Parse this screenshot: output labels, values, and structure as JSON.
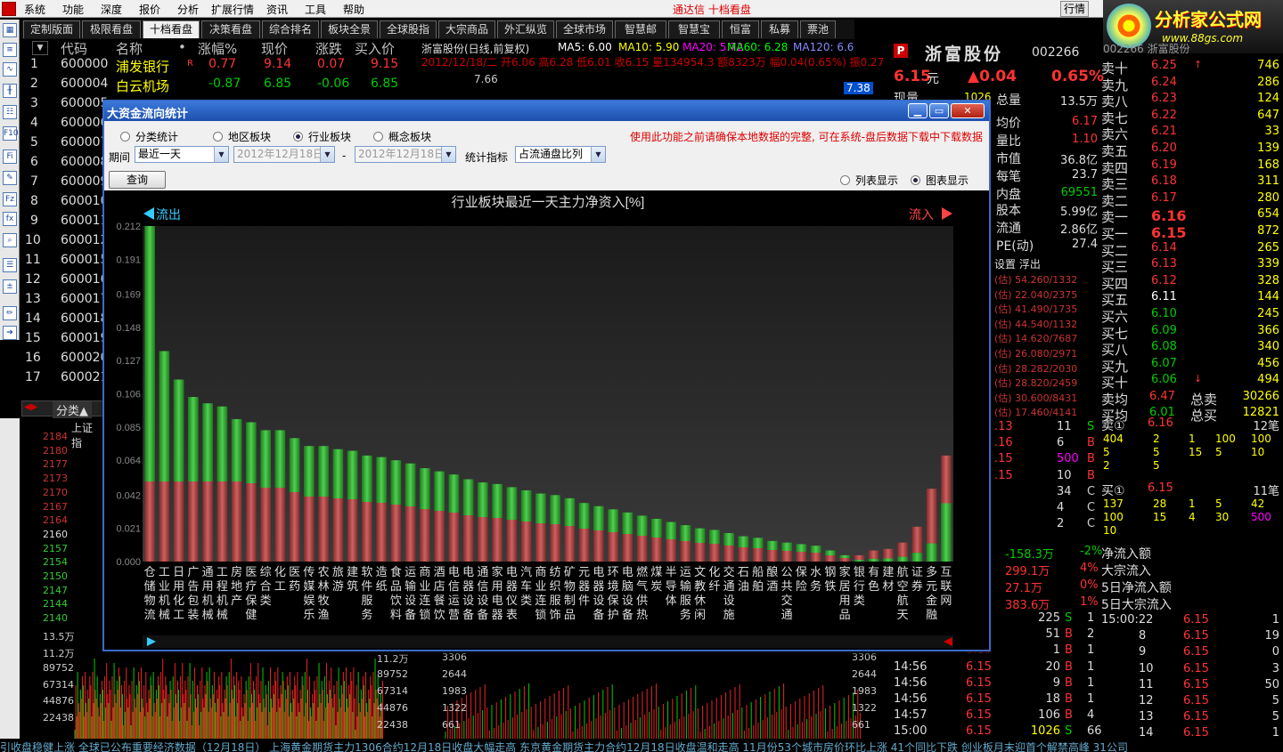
{
  "menu": {
    "items": [
      "系统",
      "功能",
      "深度",
      "报价",
      "分析",
      "扩展行情",
      "资讯",
      "工具",
      "帮助"
    ],
    "center_title": "通达信  十档看盘",
    "quote_button": "行情"
  },
  "brand": {
    "name": "分析家公式网",
    "url": "www.88gs.com"
  },
  "tabs": [
    "定制版面",
    "极限看盘",
    "十档看盘",
    "决策看盘",
    "综合排名",
    "板块全景",
    "全球股指",
    "大宗商品",
    "外汇纵览",
    "全球市场",
    "智慧邮",
    "智慧宝",
    "恒富",
    "私募",
    "票池"
  ],
  "active_tab": 2,
  "stock_list": {
    "headers": {
      "code": "代码",
      "name": "名称",
      "dot": "•",
      "change_pct": "涨幅%",
      "price": "现价",
      "change": "涨跌",
      "bid": "买入价"
    },
    "rows": [
      {
        "no": "1",
        "code": "600000",
        "name": "浦发银行",
        "flag": "R",
        "pct": "0.77",
        "price": "9.14",
        "chg": "0.07",
        "bid": "9.15"
      },
      {
        "no": "2",
        "code": "600004",
        "name": "白云机场",
        "flag": "",
        "pct": "-0.87",
        "price": "6.85",
        "chg": "-0.06",
        "bid": "6.85"
      },
      {
        "no": "3",
        "code": "600005"
      },
      {
        "no": "4",
        "code": "600006"
      },
      {
        "no": "5",
        "code": "600007"
      },
      {
        "no": "6",
        "code": "600008"
      },
      {
        "no": "7",
        "code": "600009"
      },
      {
        "no": "8",
        "code": "600010"
      },
      {
        "no": "9",
        "code": "600011"
      },
      {
        "no": "10",
        "code": "600012"
      },
      {
        "no": "11",
        "code": "600015"
      },
      {
        "no": "12",
        "code": "600016"
      },
      {
        "no": "13",
        "code": "600017"
      },
      {
        "no": "14",
        "code": "600018"
      },
      {
        "no": "15",
        "code": "600019"
      },
      {
        "no": "16",
        "code": "600020"
      },
      {
        "no": "17",
        "code": "600021"
      }
    ],
    "category_tab": "分类▲"
  },
  "kline": {
    "title": "浙富股份(日线,前复权)",
    "ma5": "MA5: 6.00",
    "ma10": "MA10: 5.90",
    "ma20": "MA20: 5.72",
    "ma60": "MA60: 6.28",
    "ma120": "MA120: 6.6",
    "line2": "2012/12/18/二 开6.06 高6.28 低6.01 收6.15 量134954.3 额8323万 幅0.04(0.65%) 振0.27",
    "high_label": "7.66",
    "price_tag": "7.38"
  },
  "index_panel": {
    "title": "上证指",
    "ticks": [
      "2184",
      "2180",
      "2177",
      "2173",
      "2170",
      "2167",
      "2164",
      "2160",
      "2157",
      "2154",
      "2150",
      "2147",
      "2144",
      "2140"
    ],
    "vol_ticks": [
      "13.5万",
      "11.2万",
      "89752",
      "67314",
      "44876",
      "22438"
    ]
  },
  "volume_panel": {
    "left_ticks": [
      "11.2万",
      "89752",
      "67314",
      "44876",
      "22438"
    ],
    "mid_ticks": [
      "3306",
      "2644",
      "1983",
      "1322",
      "661"
    ],
    "right_ticks": [
      "3306",
      "2644",
      "1983",
      "1322",
      "661"
    ]
  },
  "stock_info": {
    "name": "浙富股份",
    "code": "002266",
    "price": "6.15",
    "unit": "元",
    "chg": "▲0.04",
    "pct": "0.65%",
    "partial": "现量",
    "partial_val": "1026",
    "rows": [
      {
        "label": "总量",
        "value": "13.5万"
      },
      {
        "label": "均价",
        "value": "6.17"
      },
      {
        "label": "量比",
        "value": "1.10"
      },
      {
        "label": "市值",
        "value": "36.8亿"
      },
      {
        "label": "每笔",
        "value": "23.7"
      },
      {
        "label": "内盘",
        "value": "69551"
      },
      {
        "label": "股本",
        "value": "5.99亿"
      },
      {
        "label": "流通",
        "value": "2.86亿"
      },
      {
        "label": "PE(动)",
        "value": "27.4"
      }
    ],
    "settings": "设置 浮出",
    "est_rows": [
      "(估) 54.260/1332",
      "(估) 22.040/2375",
      "(估) 41.490/1735",
      "(估) 44.540/1132",
      "(估) 14.620/7687",
      "(估) 26.080/2971",
      "(估) 28.282/2030",
      "(估) 28.820/2459",
      "(估) 30.600/8431",
      "(估) 17.460/4141"
    ]
  },
  "orderbook": {
    "header": "002266 浙富股份",
    "asks": [
      {
        "label": "卖十",
        "price": "6.25",
        "vol": "746",
        "mark": "↑"
      },
      {
        "label": "卖九",
        "price": "6.24",
        "vol": "286"
      },
      {
        "label": "卖八",
        "price": "6.23",
        "vol": "124"
      },
      {
        "label": "卖七",
        "price": "6.22",
        "vol": "647"
      },
      {
        "label": "卖六",
        "price": "6.21",
        "vol": "33"
      },
      {
        "label": "卖五",
        "price": "6.20",
        "vol": "139"
      },
      {
        "label": "卖四",
        "price": "6.19",
        "vol": "168"
      },
      {
        "label": "卖三",
        "price": "6.18",
        "vol": "311"
      },
      {
        "label": "卖二",
        "price": "6.17",
        "vol": "280"
      },
      {
        "label": "卖一",
        "price": "6.16",
        "vol": "654"
      }
    ],
    "bids": [
      {
        "label": "买一",
        "price": "6.15",
        "vol": "872"
      },
      {
        "label": "买二",
        "price": "6.14",
        "vol": "265"
      },
      {
        "label": "买三",
        "price": "6.13",
        "vol": "339"
      },
      {
        "label": "买四",
        "price": "6.12",
        "vol": "328"
      },
      {
        "label": "买五",
        "price": "6.11",
        "vol": "144"
      },
      {
        "label": "买六",
        "price": "6.10",
        "vol": "245"
      },
      {
        "label": "买七",
        "price": "6.09",
        "vol": "366"
      },
      {
        "label": "买八",
        "price": "6.08",
        "vol": "340"
      },
      {
        "label": "买九",
        "price": "6.07",
        "vol": "456"
      },
      {
        "label": "买十",
        "price": "6.06",
        "vol": "494",
        "mark": "↓"
      }
    ],
    "avg_sell": {
      "label": "卖均",
      "price": "6.47",
      "tlabel": "总卖",
      "total": "30266"
    },
    "avg_buy": {
      "label": "买均",
      "price": "6.01",
      "tlabel": "总买",
      "total": "12821"
    },
    "sell1_queue": {
      "label": "卖①",
      "price": "6.16",
      "count": "12笔",
      "rows": [
        [
          "404",
          "2",
          "1",
          "100",
          "100"
        ],
        [
          "5",
          "5",
          "15",
          "5",
          "10"
        ],
        [
          "2",
          "5",
          "",
          "",
          ""
        ]
      ]
    },
    "buy1_queue": {
      "label": "买①",
      "price": "6.15",
      "count": "11笔",
      "rows": [
        [
          "137",
          "28",
          "1",
          "5",
          "42"
        ],
        [
          "100",
          "15",
          "4",
          "30",
          "500"
        ],
        [
          "10",
          "",
          "",
          "",
          ""
        ]
      ]
    },
    "flow": [
      {
        "label": "净流入额",
        "value": "-158.3万",
        "pct": "-2%"
      },
      {
        "label": "大宗流入",
        "value": "299.1万",
        "pct": "4%"
      },
      {
        "label": "5日净流入额",
        "value": "27.1万",
        "pct": "0%"
      },
      {
        "label": "5日大宗流入",
        "value": "383.6万",
        "pct": "1%"
      }
    ],
    "ticks": [
      {
        "t": "15:00:22",
        "p": "6.15",
        "v": "1",
        "d": ""
      },
      {
        "t": "8",
        "p": "6.15",
        "v": "19",
        "d": ""
      },
      {
        "t": "9",
        "p": "6.15",
        "v": "0",
        "d": ""
      },
      {
        "t": "10",
        "p": "6.15",
        "v": "3",
        "d": ""
      },
      {
        "t": "11",
        "p": "6.15",
        "v": "50",
        "d": ""
      },
      {
        "t": "12",
        "p": "6.15",
        "v": "5",
        "d": ""
      },
      {
        "t": "13",
        "p": "6.15",
        "v": "5",
        "d": ""
      },
      {
        "t": "14",
        "p": "6.15",
        "v": "1",
        "d": ""
      }
    ]
  },
  "trades": [
    {
      "p": ".13",
      "v": "11",
      "d": "S"
    },
    {
      "p": ".16",
      "v": "6",
      "d": "B"
    },
    {
      "p": ".15",
      "v": "500",
      "d": "B"
    },
    {
      "p": ".15",
      "v": "10",
      "d": "B"
    },
    {
      "p": "",
      "v": "34",
      "d": "C"
    },
    {
      "p": "",
      "v": "4",
      "d": "C"
    },
    {
      "p": "",
      "v": "2",
      "d": "C"
    }
  ],
  "trades2": [
    {
      "t": "",
      "p": "6.15",
      "v": "225",
      "d": "S",
      "n": "1"
    },
    {
      "t": "",
      "p": "6.15",
      "v": "51",
      "d": "B",
      "n": "2"
    },
    {
      "t": "",
      "p": "6.15",
      "v": "1",
      "d": "B",
      "n": "1"
    },
    {
      "t": "14:56",
      "p": "6.15",
      "v": "20",
      "d": "B",
      "n": "1"
    },
    {
      "t": "14:56",
      "p": "6.15",
      "v": "9",
      "d": "B",
      "n": "1"
    },
    {
      "t": "14:56",
      "p": "6.15",
      "v": "18",
      "d": "B",
      "n": "1"
    },
    {
      "t": "14:57",
      "p": "6.15",
      "v": "106",
      "d": "B",
      "n": "4"
    },
    {
      "t": "15:00",
      "p": "6.15",
      "v": "1026",
      "d": "S",
      "n": "66"
    }
  ],
  "ticker": "引收盘稳健上涨     全球已公布重要经济数据（12月18日）     上海黄金期货主力1306合约12月18日收盘大幅走高     东京黄金期货主力合约12月18日收盘温和走高     11月份53个城市房价环比上涨 41个同比下跌     创业板月末迎首个解禁高峰 31公司",
  "modal": {
    "title": "大资金流向统计",
    "radios": [
      {
        "label": "分类统计",
        "on": false
      },
      {
        "label": "地区板块",
        "on": false
      },
      {
        "label": "行业板块",
        "on": true
      },
      {
        "label": "概念板块",
        "on": false
      }
    ],
    "warning": "使用此功能之前请确保本地数据的完整, 可在系统-盘后数据下载中下载数据",
    "period_label": "期间",
    "period_value": "最近一天",
    "date_from": "2012年12月18日",
    "dash": "-",
    "date_to": "2012年12月18日",
    "metric_label": "统计指标",
    "metric_value": "占流通盘比列",
    "query_button": "查询",
    "view_list": "列表显示",
    "view_chart": "图表显示",
    "view_chart_on": true,
    "outflow_label": "流出",
    "inflow_label": "流入"
  },
  "chart_data": {
    "type": "bar",
    "title": "行业板块最近一天主力净资入[%]",
    "ylim": [
      0,
      0.212
    ],
    "y_ticks": [
      "0.212",
      "0.191",
      "0.169",
      "0.148",
      "0.127",
      "0.106",
      "0.085",
      "0.064",
      "0.042",
      "0.021",
      "0.000"
    ],
    "categories": [
      "仓储物流",
      "工业机械",
      "日用化工",
      "广告包装",
      "通用机械",
      "工程机械",
      "房地产",
      "医疗保健",
      "综合类",
      "化工",
      "医药",
      "传媒娱乐",
      "农林牧渔",
      "旅游",
      "建筑",
      "软件服务",
      "造纸",
      "食品饮料",
      "运输设备",
      "商业连锁",
      "酒店餐饮",
      "电信运营",
      "电器设备",
      "通信设备",
      "家用电器",
      "电器仪表",
      "汽车类",
      "商业连锁",
      "纺织服饰",
      "矿物制品",
      "元器件",
      "电器设备",
      "环境保护",
      "电脑设备",
      "燃气供热",
      "煤炭",
      "半导体",
      "运输服务",
      "文教休闲",
      "化纤",
      "交通设施",
      "石油",
      "船舶",
      "酿酒",
      "公共交通",
      "保险",
      "水务",
      "钢铁",
      "家居用品",
      "银行类",
      "有色",
      "建材",
      "航空航天",
      "证券",
      "多元金融",
      "互联网"
    ],
    "series": [
      {
        "name": "流出",
        "values": [
          0.212,
          0.133,
          0.115,
          0.104,
          0.1,
          0.098,
          0.09,
          0.088,
          0.083,
          0.083,
          0.078,
          0.073,
          0.073,
          0.071,
          0.07,
          0.067,
          0.066,
          0.064,
          0.062,
          0.059,
          0.057,
          0.055,
          0.052,
          0.05,
          0.049,
          0.047,
          0.045,
          0.043,
          0.042,
          0.04,
          0.037,
          0.035,
          0.033,
          0.031,
          0.029,
          0.027,
          0.025,
          0.023,
          0.021,
          0.02,
          0.018,
          0.016,
          0.015,
          0.013,
          0.012,
          0.011,
          0.01,
          0.007,
          0.004
        ]
      },
      {
        "name": "流入",
        "values": [
          0.004,
          0.007,
          0.008,
          0.012,
          0.022,
          0.046,
          0.067,
          0.141,
          0.213
        ]
      }
    ]
  }
}
